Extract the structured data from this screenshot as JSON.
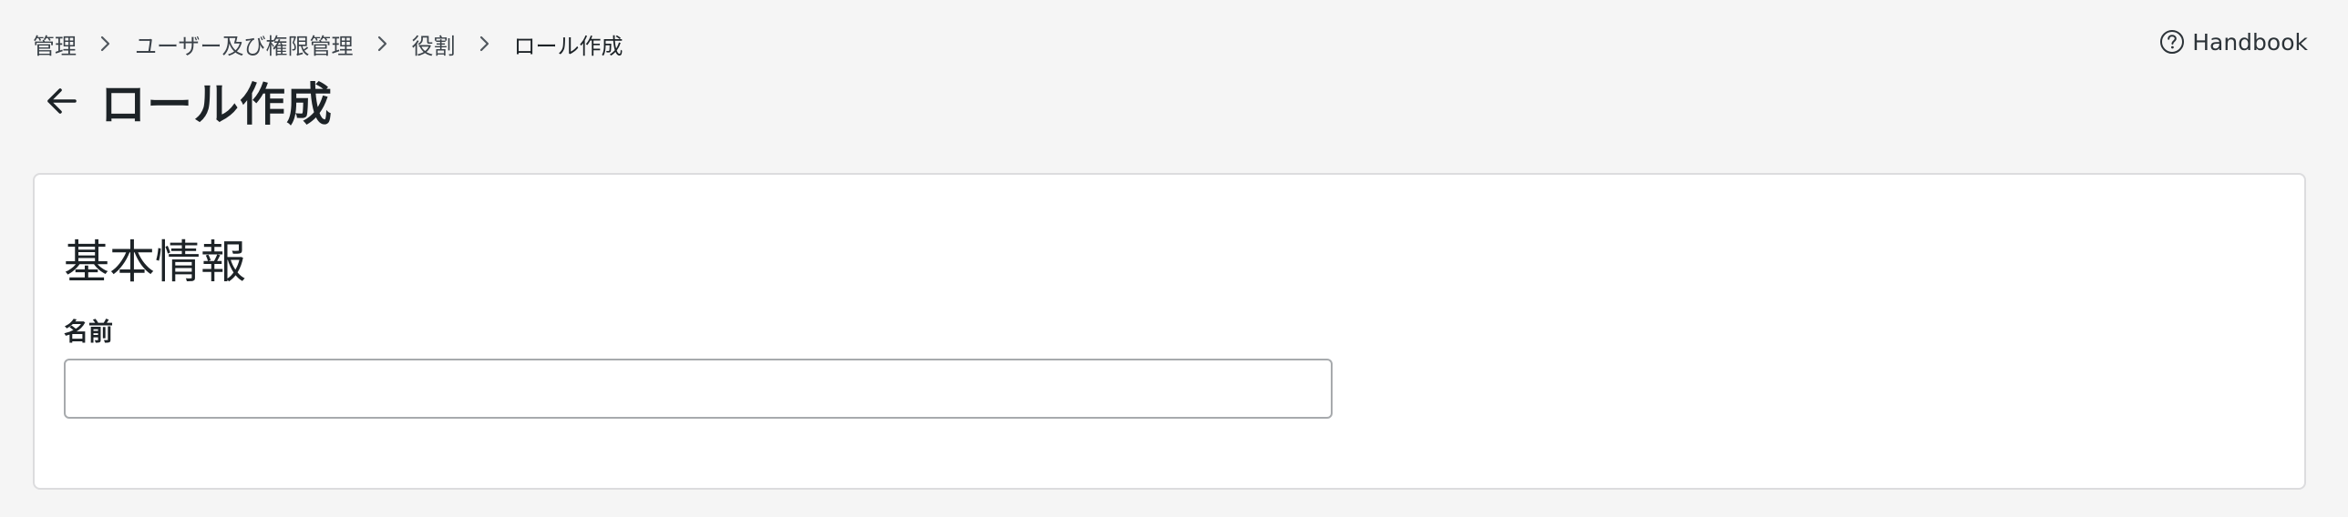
{
  "breadcrumb": {
    "items": [
      {
        "label": "管理"
      },
      {
        "label": "ユーザー及び権限管理"
      },
      {
        "label": "役割"
      },
      {
        "label": "ロール作成"
      }
    ],
    "separator_icon": "chevron-right-icon"
  },
  "help": {
    "label": "Handbook",
    "icon": "question-circle-icon"
  },
  "page": {
    "back_icon": "arrow-left-icon",
    "title": "ロール作成"
  },
  "section": {
    "title": "基本情報",
    "fields": {
      "name": {
        "label": "名前",
        "value": "",
        "placeholder": ""
      }
    }
  },
  "colors": {
    "background": "#f5f5f5",
    "card": "#ffffff",
    "border": "#dcdcde",
    "input_border": "#a7aaad",
    "text": "#1d2327"
  }
}
